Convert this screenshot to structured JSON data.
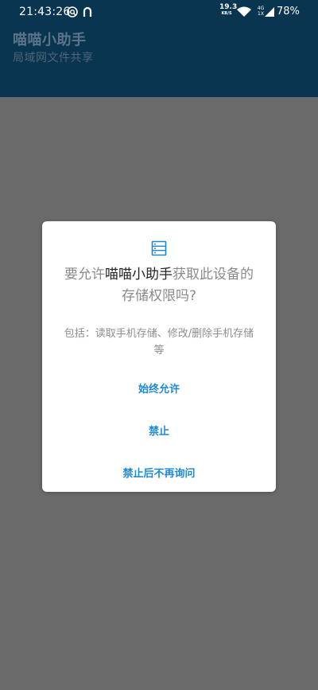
{
  "status_bar": {
    "time": "21:43:26",
    "net_speed": "19.3",
    "net_unit": "KB/S",
    "net_type_top": "4G",
    "net_type_bottom": "1X",
    "battery": "78%",
    "icons": [
      "at-icon",
      "magnet-icon",
      "wifi-icon",
      "signal-icon"
    ]
  },
  "app_bar": {
    "title": "喵喵小助手",
    "subtitle": "局域网文件共享",
    "color": "#0a3551"
  },
  "dialog": {
    "icon": "storage-icon",
    "message_prefix": "要允许",
    "app_name": "喵喵小助手",
    "message_suffix": "获取此设备的存储权限吗?",
    "detail": "包括：读取手机存储、修改/删除手机存储等",
    "actions": {
      "allow_always": "始终允许",
      "deny": "禁止",
      "deny_dont_ask": "禁止后不再询问"
    },
    "accent_color": "#1e88d3"
  }
}
